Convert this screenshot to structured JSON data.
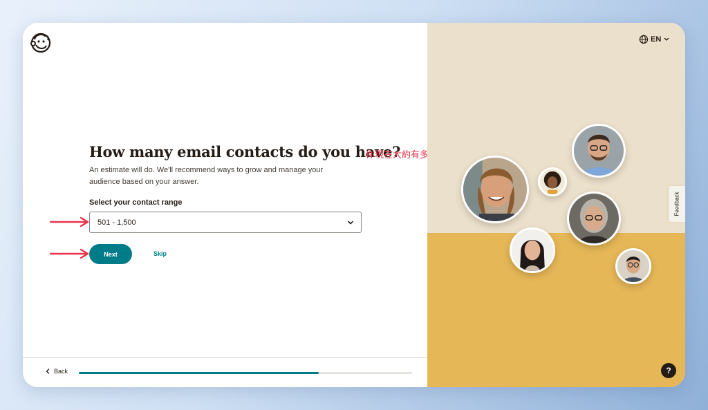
{
  "header": {
    "logo_icon": "mailchimp-freddie-icon",
    "language": "EN",
    "language_icon": "globe-icon"
  },
  "main": {
    "title": "How many email contacts do you have?",
    "annotation": "你現在大約有多少聯絡人？",
    "subtitle": "An estimate will do. We'll recommend ways to grow and manage your audience based on your answer.",
    "field_label": "Select your contact range",
    "selected_range": "501 - 1,500",
    "next_label": "Next",
    "skip_label": "Skip"
  },
  "footer": {
    "back_label": "Back",
    "progress_fraction": 0.72
  },
  "sidebar": {
    "feedback_label": "Feedback",
    "help_label": "?"
  },
  "colors": {
    "accent": "#007c89",
    "annotation_red": "#e8334a",
    "panel_beige": "#ebe0cb",
    "panel_yellow": "#e6b757"
  }
}
